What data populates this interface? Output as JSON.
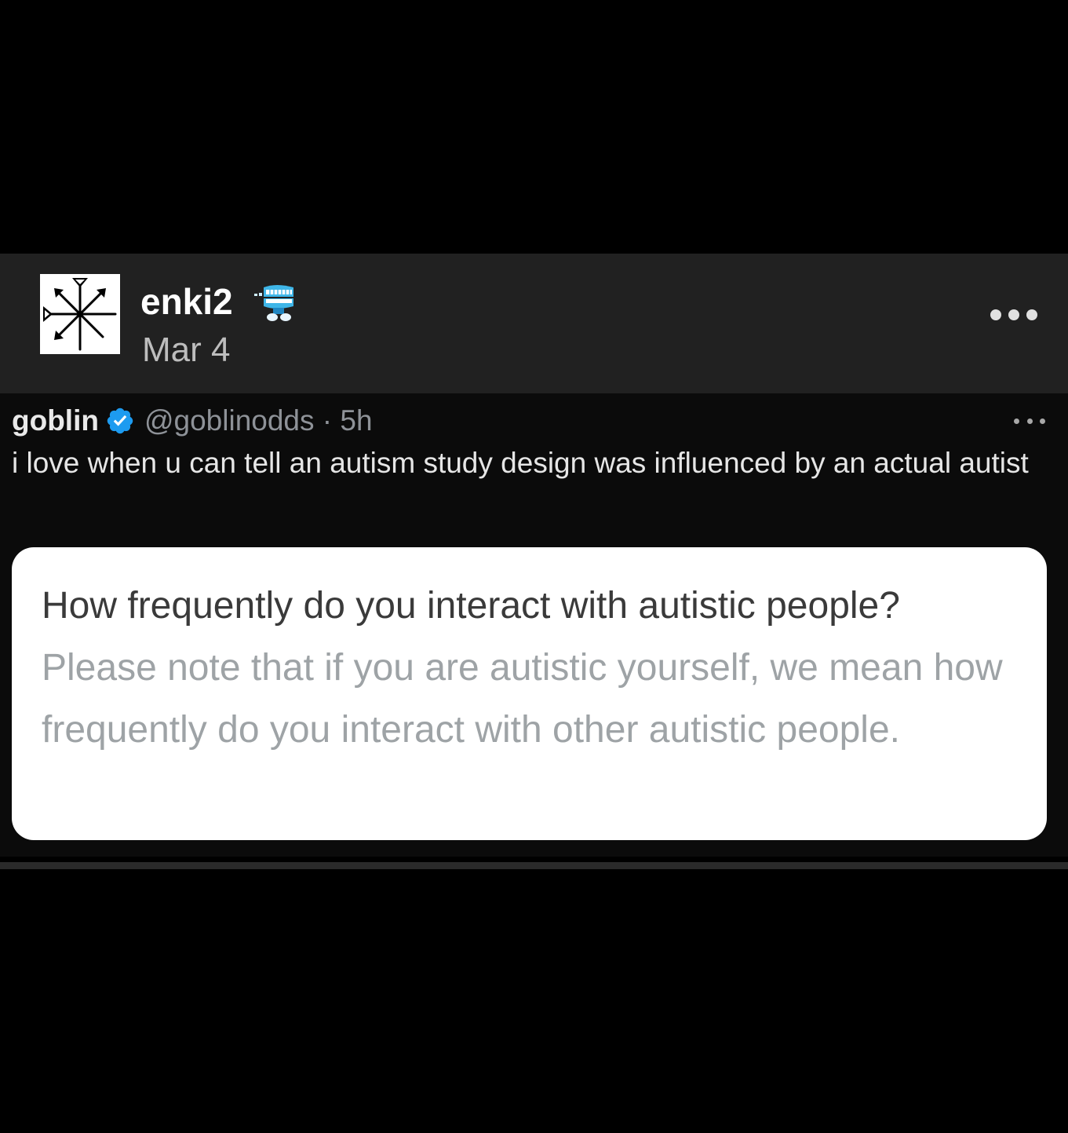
{
  "post": {
    "author": "enki2",
    "date": "Mar 4",
    "badge_icon": "chattering-teeth-icon",
    "more_icon": "more-options-icon"
  },
  "tweet": {
    "display_name": "goblin",
    "verified_icon": "verified-badge-icon",
    "handle_time": "@goblinodds · 5h",
    "text": "i love when u can tell an autism study design was influenced by an actual autist",
    "more_icon": "more-options-icon"
  },
  "quoted_card": {
    "question": "How frequently do you interact with autistic people?",
    "note": "Please note that if you are autistic yourself, we mean how frequently do you interact with other autistic people."
  },
  "colors": {
    "background": "#000000",
    "header_bg": "#212121",
    "verified_blue": "#1d9bf0",
    "card_bg": "#ffffff",
    "note_gray": "#9ea3a6"
  }
}
